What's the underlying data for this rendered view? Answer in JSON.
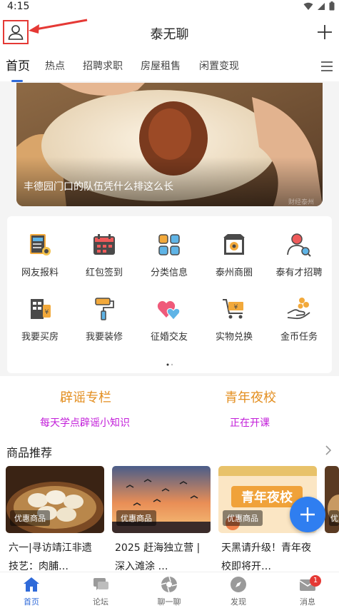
{
  "status_bar": {
    "time": "4:15"
  },
  "header": {
    "title": "泰无聊"
  },
  "tabs": [
    {
      "label": "首页",
      "active": true
    },
    {
      "label": "热点"
    },
    {
      "label": "招聘求职"
    },
    {
      "label": "房屋租售"
    },
    {
      "label": "闲置变现"
    }
  ],
  "banner": {
    "caption": "丰德园门口的队伍凭什么排这么长",
    "watermark": "财经泰州"
  },
  "grid": {
    "items": [
      {
        "label": "网友报料",
        "icon": "news-report-icon"
      },
      {
        "label": "红包签到",
        "icon": "calendar-checkin-icon"
      },
      {
        "label": "分类信息",
        "icon": "category-icon"
      },
      {
        "label": "泰州商圈",
        "icon": "store-icon"
      },
      {
        "label": "泰有才招聘",
        "icon": "recruit-icon"
      },
      {
        "label": "我要买房",
        "icon": "house-buy-icon"
      },
      {
        "label": "我要装修",
        "icon": "paint-roller-icon"
      },
      {
        "label": "征婚交友",
        "icon": "hearts-icon"
      },
      {
        "label": "实物兑换",
        "icon": "cart-exchange-icon"
      },
      {
        "label": "金币任务",
        "icon": "coin-task-icon"
      }
    ]
  },
  "promo": {
    "left": {
      "title": "辟谣专栏",
      "subtitle": "每天学点辟谣小知识"
    },
    "right": {
      "title": "青年夜校",
      "subtitle": "正在开课"
    }
  },
  "products": {
    "title": "商品推荐",
    "items": [
      {
        "badge": "优惠商品",
        "text": "六一|寻访靖江非遗技艺：肉脯…"
      },
      {
        "badge": "优惠商品",
        "text": "2025 赶海独立营 | 深入滩涂 …"
      },
      {
        "badge": "优惠商品",
        "text": "天黑请升级！青年夜校即将开…",
        "image_text": "青年夜校"
      },
      {
        "badge": "优惠商品",
        "text": ""
      }
    ]
  },
  "bottom_nav": [
    {
      "label": "首页",
      "active": true
    },
    {
      "label": "论坛"
    },
    {
      "label": "聊一聊"
    },
    {
      "label": "发现"
    },
    {
      "label": "消息",
      "badge": "1"
    }
  ],
  "colors": {
    "accent": "#2f6ad9",
    "promo_title": "#e38e1f",
    "promo_sub": "#c21ed9",
    "annotation": "#e53935"
  }
}
